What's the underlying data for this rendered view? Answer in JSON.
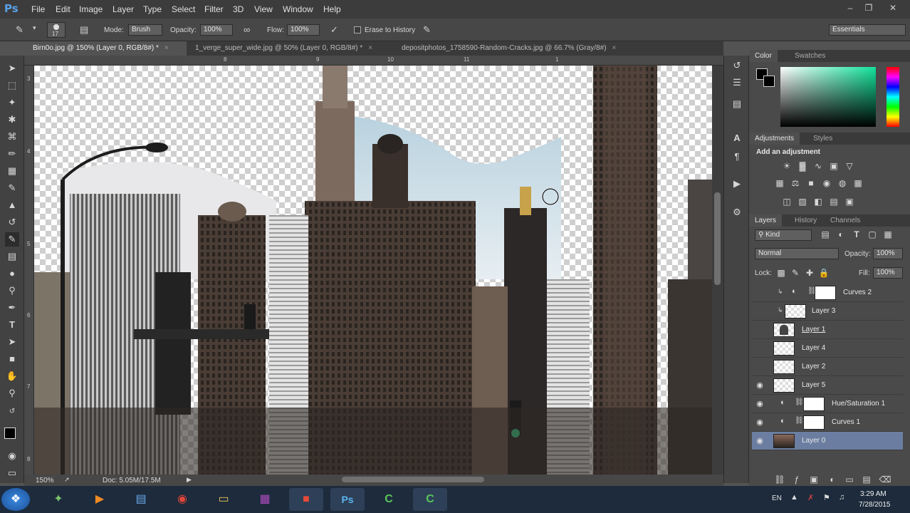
{
  "app": {
    "logo": "Ps"
  },
  "menu": [
    "File",
    "Edit",
    "Image",
    "Layer",
    "Type",
    "Select",
    "Filter",
    "3D",
    "View",
    "Window",
    "Help"
  ],
  "options": {
    "brush_size": "17",
    "mode_label": "Mode:",
    "mode_value": "Brush",
    "opacity_label": "Opacity:",
    "opacity_value": "100%",
    "flow_label": "Flow:",
    "flow_value": "100%",
    "erase_history": "Erase to History",
    "workspace": "Essentials"
  },
  "tabs": [
    {
      "label": "Birn0o.jpg @ 150% (Layer 0, RGB/8#) *",
      "close": "×"
    },
    {
      "label": "1_verge_super_wide.jpg @ 50% (Layer 0, RGB/8#) *",
      "close": "×"
    },
    {
      "label": "depositphotos_1758590-Random-Cracks.jpg @ 66.7% (Gray/8#)",
      "close": "×"
    }
  ],
  "ruler_top": [
    "8",
    "9",
    "10",
    "11",
    "1"
  ],
  "ruler_left": [
    "3",
    "4",
    "5",
    "6",
    "7",
    "8"
  ],
  "status": {
    "zoom": "150%",
    "doc": "Doc: 5.05M/17.5M"
  },
  "color_panel": {
    "tabs": [
      "Color",
      "Swatches"
    ]
  },
  "adjustments": {
    "tabs": [
      "Adjustments",
      "Styles"
    ],
    "title": "Add an adjustment"
  },
  "layers_panel": {
    "tabs": [
      "Layers",
      "History",
      "Channels"
    ],
    "kind": "Kind",
    "blend": "Normal",
    "opacity_label": "Opacity:",
    "opacity_value": "100%",
    "lock_label": "Lock:",
    "fill_label": "Fill:",
    "fill_value": "100%",
    "layers": [
      {
        "name": "Curves 2",
        "visible": false
      },
      {
        "name": "Layer 3",
        "visible": false
      },
      {
        "name": "Layer 1",
        "visible": false
      },
      {
        "name": "Layer 4",
        "visible": false
      },
      {
        "name": "Layer 2",
        "visible": false
      },
      {
        "name": "Layer 5",
        "visible": true
      },
      {
        "name": "Hue/Saturation 1",
        "visible": true
      },
      {
        "name": "Curves 1",
        "visible": true
      },
      {
        "name": "Layer 0",
        "visible": true
      }
    ]
  },
  "taskbar": {
    "lang": "EN",
    "time": "3:29 AM",
    "date": "7/28/2015"
  },
  "colors": {
    "accent": "#6b7ea1",
    "menubar": "#3c3c3c",
    "taskbar": "#1d2b3c"
  }
}
